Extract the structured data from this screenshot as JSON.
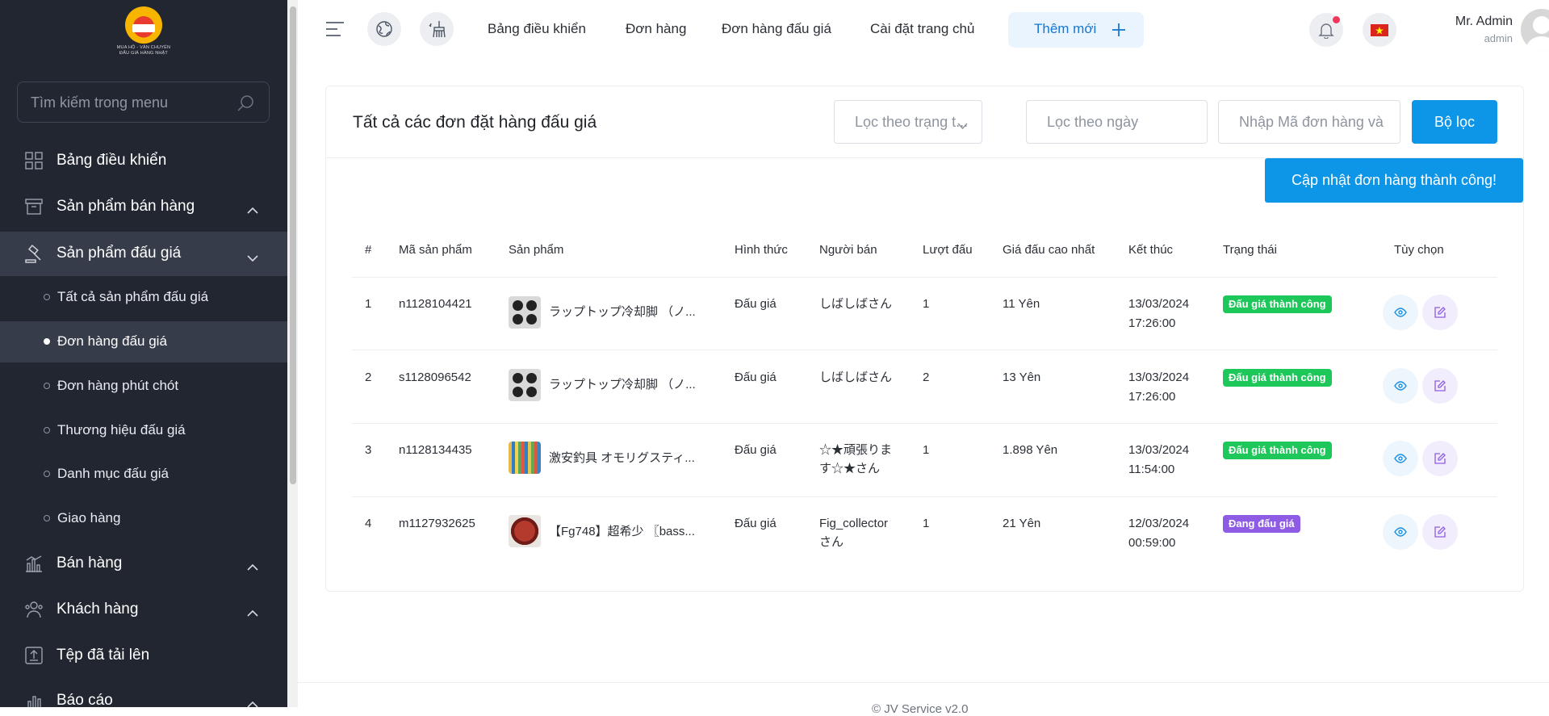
{
  "logo": {
    "text": "MUA HỘ - VẬN CHUYỂN\nĐẤU GIÁ HÀNG NHẬT"
  },
  "sidebar": {
    "search_placeholder": "Tìm kiếm trong menu",
    "items": [
      {
        "label": "Bảng điều khiển",
        "icon": "dashboard-grid-icon",
        "chevron": null
      },
      {
        "label": "Sản phẩm bán hàng",
        "icon": "box-icon",
        "chevron": "up"
      },
      {
        "label": "Sản phẩm đấu giá",
        "icon": "auction-gavel-icon",
        "chevron": "down"
      },
      {
        "label": "Bán hàng",
        "icon": "bar-chart-icon",
        "chevron": "up"
      },
      {
        "label": "Khách hàng",
        "icon": "users-icon",
        "chevron": "up"
      },
      {
        "label": "Tệp đã tải lên",
        "icon": "upload-icon",
        "chevron": null
      },
      {
        "label": "Báo cáo",
        "icon": "report-icon",
        "chevron": "up"
      }
    ],
    "subitems": [
      {
        "label": "Tất cả sản phẩm đấu giá"
      },
      {
        "label": "Đơn hàng đấu giá"
      },
      {
        "label": "Đơn hàng phút chót"
      },
      {
        "label": "Thương hiệu đấu giá"
      },
      {
        "label": "Danh mục đấu giá"
      },
      {
        "label": "Giao hàng"
      }
    ]
  },
  "topbar": {
    "links": [
      "Bảng điều khiển",
      "Đơn hàng",
      "Đơn hàng đấu giá",
      "Cài đặt trang chủ"
    ],
    "add_label": "Thêm mới",
    "user_name": "Mr. Admin",
    "user_role": "admin"
  },
  "card": {
    "title": "Tất cả các đơn đặt hàng đấu giá",
    "filter_status_placeholder": "Lọc theo trạng t...",
    "filter_date_placeholder": "Lọc theo ngày",
    "filter_code_placeholder": "Nhập Mã đơn hàng và",
    "filter_button": "Bộ lọc",
    "toast": "Cập nhật đơn hàng thành công!"
  },
  "table": {
    "headers": [
      "#",
      "Mã sản phẩm",
      "Sản phẩm",
      "Hình thức",
      "Người bán",
      "Lượt đấu",
      "Giá đấu cao nhất",
      "Kết thúc",
      "Trạng thái",
      "Tùy chọn"
    ],
    "rows": [
      {
        "no": "1",
        "code": "n1128104421",
        "product": "ラップトップ冷却脚 （ノ...",
        "type": "Đấu giá",
        "seller": "しばしばさん",
        "bids": "1",
        "price": "11 Yên",
        "end_date": "13/03/2024",
        "end_time": "17:26:00",
        "status": "Đấu giá thành công",
        "status_color": "#1ec75a",
        "image": "cooler-pads"
      },
      {
        "no": "2",
        "code": "s1128096542",
        "product": "ラップトップ冷却脚 （ノ...",
        "type": "Đấu giá",
        "seller": "しばしばさん",
        "bids": "2",
        "price": "13 Yên",
        "end_date": "13/03/2024",
        "end_time": "17:26:00",
        "status": "Đấu giá thành công",
        "status_color": "#1ec75a",
        "image": "cooler-pads"
      },
      {
        "no": "3",
        "code": "n1128134435",
        "product": "激安釣具 オモリグスティ...",
        "type": "Đấu giá",
        "seller": "☆★頑張りま\nす☆★さん",
        "bids": "1",
        "price": "1.898 Yên",
        "end_date": "13/03/2024",
        "end_time": "11:54:00",
        "status": "Đấu giá thành công",
        "status_color": "#1ec75a",
        "image": "fishing-lures"
      },
      {
        "no": "4",
        "code": "m1127932625",
        "product": "【Fg748】超希少 〖bass...",
        "type": "Đấu giá",
        "seller": "Fig_collector\nさん",
        "bids": "1",
        "price": "21 Yên",
        "end_date": "12/03/2024",
        "end_time": "00:59:00",
        "status": "Đang đấu giá",
        "status_color": "#8e5ce4",
        "image": "fish-figure"
      }
    ]
  },
  "footer": {
    "text": "© JV Service v2.0"
  }
}
